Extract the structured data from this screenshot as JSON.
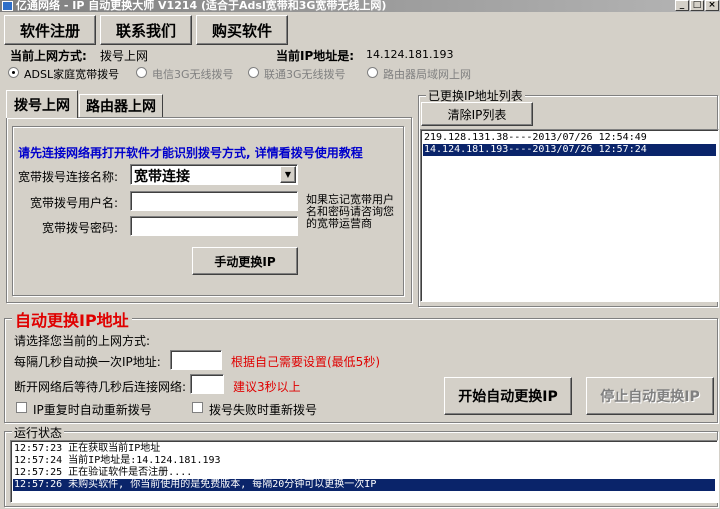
{
  "window": {
    "title": "亿通网络 - IP 自动更换大师 V1214 (适合于Adsl宽带和3G宽带无线上网)"
  },
  "toolbar": {
    "register": "软件注册",
    "contact": "联系我们",
    "buy": "购买软件"
  },
  "status_line": {
    "mode_label": "当前上网方式:",
    "mode_value": "拨号上网",
    "ip_label": "当前IP地址是:",
    "ip_value": "14.124.181.193"
  },
  "connection_modes": [
    {
      "label": "ADSL家庭宽带拨号",
      "selected": true
    },
    {
      "label": "电信3G无线拨号",
      "selected": false
    },
    {
      "label": "联通3G无线拨号",
      "selected": false
    },
    {
      "label": "路由器局域网上网",
      "selected": false
    }
  ],
  "tabs": [
    {
      "label": "拨号上网"
    },
    {
      "label": "路由器上网"
    }
  ],
  "dial_panel": {
    "hint": "请先连接网络再打开软件才能识别拨号方式, 详情看拨号使用教程",
    "conn_name_label": "宽带拨号连接名称:",
    "conn_name_value": "宽带连接",
    "user_label": "宽带拨号用户名:",
    "user_value": "",
    "pass_label": "宽带拨号密码:",
    "pass_value": "",
    "side_note": "如果忘记宽带用户名和密码请咨询您的宽带运营商",
    "manual_button": "手动更换IP"
  },
  "ip_list": {
    "title": "已更换IP地址列表",
    "clear_button": "清除IP列表",
    "items": [
      {
        "text": "219.128.131.38----2013/07/26 12:54:49",
        "selected": false
      },
      {
        "text": "14.124.181.193----2013/07/26 12:57:24",
        "selected": true
      }
    ]
  },
  "auto": {
    "title": "自动更换IP地址",
    "choose_label": "请选择您当前的上网方式:",
    "interval_label": "每隔几秒自动换一次IP地址:",
    "interval_value": "",
    "interval_hint": "根据自己需要设置(最低5秒)",
    "reconnect_label": "断开网络后等待几秒后连接网络:",
    "reconnect_value": "",
    "reconnect_hint": "建议3秒以上",
    "check_repeat": "IP重复时自动重新拨号",
    "check_fail": "拨号失败时重新拨号",
    "start_button": "开始自动更换IP",
    "stop_button": "停止自动更换IP"
  },
  "log": {
    "title": "运行状态",
    "entries": [
      {
        "text": "12:57:23 正在获取当前IP地址",
        "selected": false
      },
      {
        "text": "12:57:24 当前IP地址是:14.124.181.193",
        "selected": false
      },
      {
        "text": "12:57:25 正在验证软件是否注册....",
        "selected": false
      },
      {
        "text": "12:57:26 未购买软件, 你当前使用的是免费版本, 每隔20分钟可以更换一次IP",
        "selected": true
      }
    ]
  }
}
